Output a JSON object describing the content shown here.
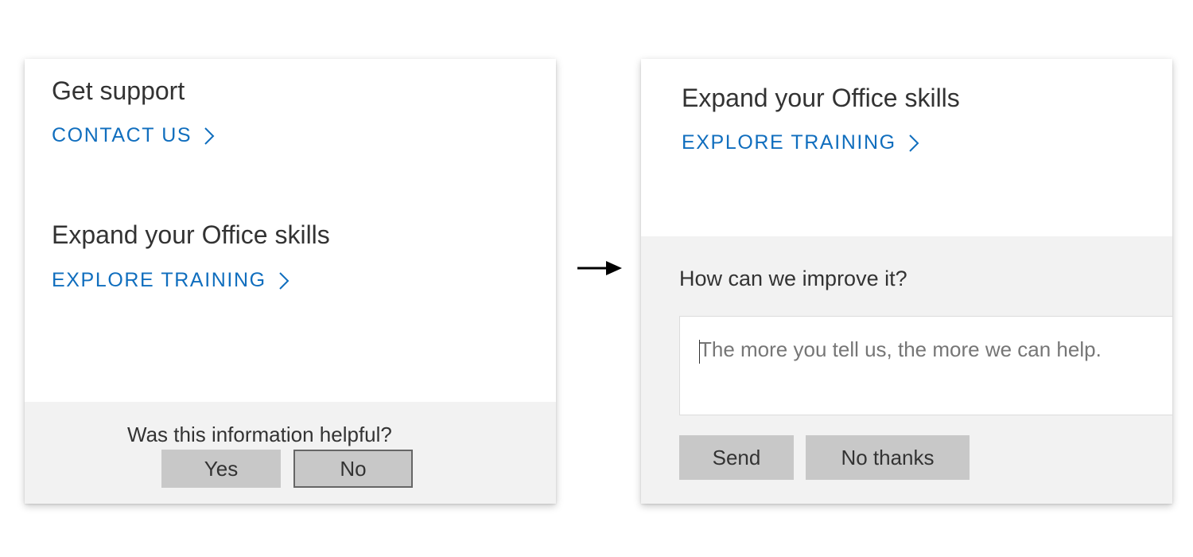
{
  "left_panel": {
    "support_heading": "Get support",
    "contact_link": "CONTACT US",
    "skills_heading": "Expand your Office skills",
    "training_link": "EXPLORE TRAINING",
    "helpful_question": "Was this information helpful?",
    "yes_label": "Yes",
    "no_label": "No"
  },
  "right_panel": {
    "skills_heading": "Expand your Office skills",
    "training_link": "EXPLORE TRAINING",
    "improve_question": "How can we improve it?",
    "feedback_placeholder": "The more you tell us, the more we can help.",
    "feedback_value": "",
    "send_label": "Send",
    "no_thanks_label": "No thanks"
  },
  "icons": {
    "link_chevron": "chevron-right-icon",
    "transition_arrow": "arrow-right-icon"
  },
  "colors": {
    "link": "#106ebe",
    "footer_background": "#f2f2f2",
    "button_background": "#c8c8c8",
    "text": "#333333",
    "placeholder": "#767676"
  }
}
